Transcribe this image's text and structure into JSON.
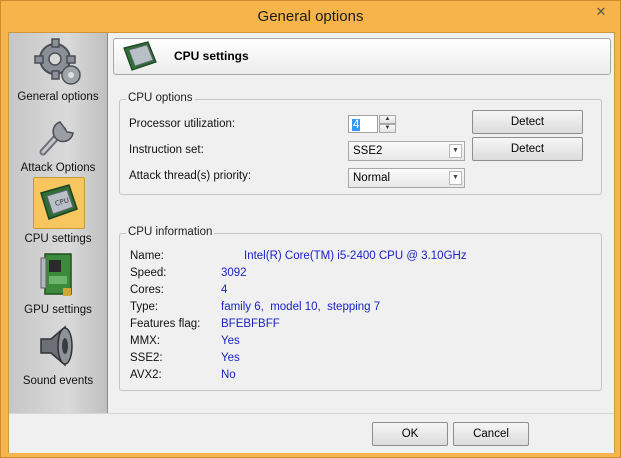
{
  "window": {
    "title": "General options",
    "close_glyph": "✕"
  },
  "sidebar": {
    "items": [
      {
        "label": "General options",
        "icon": "gear-icon"
      },
      {
        "label": "Attack Options",
        "icon": "wrench-icon"
      },
      {
        "label": "CPU settings",
        "icon": "cpu-icon",
        "selected": true
      },
      {
        "label": "GPU settings",
        "icon": "gpu-card-icon"
      },
      {
        "label": "Sound events",
        "icon": "speaker-icon"
      }
    ]
  },
  "header": {
    "title": "CPU settings",
    "icon_text": "CPU"
  },
  "cpu_options": {
    "legend": "CPU options",
    "processor_utilization_label": "Processor utilization:",
    "processor_utilization_value": "4",
    "instruction_set_label": "Instruction set:",
    "instruction_set_value": "SSE2",
    "thread_priority_label": "Attack thread(s) priority:",
    "thread_priority_value": "Normal",
    "detect_label": "Detect"
  },
  "cpu_info": {
    "legend": "CPU information",
    "rows": [
      {
        "label": "Name:",
        "value": "Intel(R) Core(TM) i5-2400 CPU @ 3.10GHz"
      },
      {
        "label": "Speed:",
        "value": "3092"
      },
      {
        "label": "Cores:",
        "value": "4"
      },
      {
        "label": "Type:",
        "value": "family 6,  model 10,  stepping 7"
      },
      {
        "label": "Features flag:",
        "value": "BFEBFBFF"
      },
      {
        "label": "MMX:",
        "value": "Yes"
      },
      {
        "label": "SSE2:",
        "value": "Yes"
      },
      {
        "label": "AVX2:",
        "value": "No"
      }
    ]
  },
  "footer": {
    "ok_label": "OK",
    "cancel_label": "Cancel"
  },
  "colors": {
    "accent": "#f6b44a",
    "value_text": "#1a22c4",
    "selection": "#f7c65e"
  }
}
